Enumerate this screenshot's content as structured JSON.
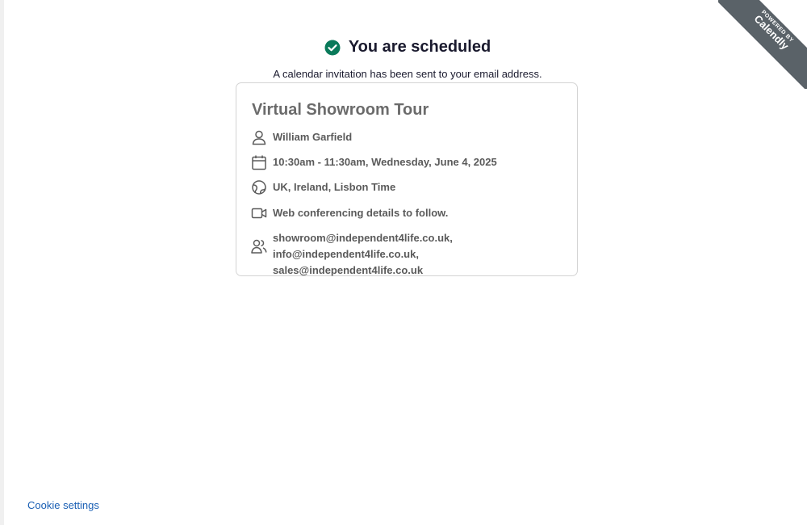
{
  "header": {
    "title": "You are scheduled",
    "subtitle": "A calendar invitation has been sent to your email address."
  },
  "event": {
    "title": "Virtual Showroom Tour",
    "host": "William Garfield",
    "datetime": "10:30am - 11:30am, Wednesday, June 4, 2025",
    "timezone": "UK, Ireland, Lisbon Time",
    "location": "Web conferencing details to follow.",
    "guests_line1": "showroom@independent4life.co.uk,",
    "guests_line2": "info@independent4life.co.uk, sales@independent4life.co.uk"
  },
  "footer": {
    "cookie_settings": "Cookie settings"
  },
  "badge": {
    "small": "POWERED BY",
    "brand": "Calendly"
  },
  "colors": {
    "check": "#0a7a5a",
    "link": "#1a5fb4",
    "ribbon": "#5a6268"
  },
  "icons": [
    "check-circle-icon",
    "person-icon",
    "calendar-icon",
    "globe-icon",
    "video-camera-icon",
    "people-icon"
  ]
}
